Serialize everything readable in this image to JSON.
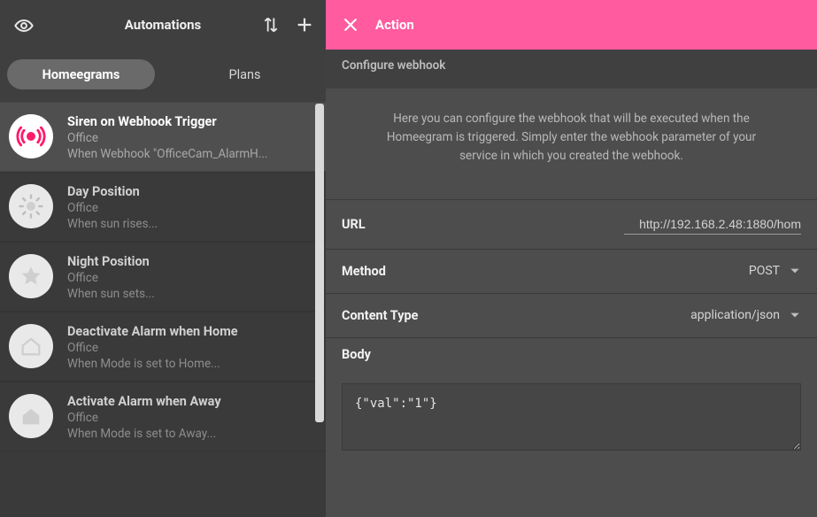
{
  "colors": {
    "accent": "#ff5b9e"
  },
  "sidebar": {
    "title": "Automations",
    "tabs": {
      "homeegrams": "Homeegrams",
      "plans": "Plans",
      "activeIndex": 0
    },
    "items": [
      {
        "title": "Siren on Webhook Trigger",
        "sub": "Office",
        "cond": "When Webhook \"OfficeCam_AlarmH...",
        "icon": "siren",
        "active": true
      },
      {
        "title": "Day Position",
        "sub": "Office",
        "cond": "When sun rises...",
        "icon": "sun",
        "active": false
      },
      {
        "title": "Night Position",
        "sub": "Office",
        "cond": "When sun sets...",
        "icon": "star",
        "active": false
      },
      {
        "title": "Deactivate Alarm when Home",
        "sub": "Office",
        "cond": "When Mode is set to Home...",
        "icon": "home",
        "active": false
      },
      {
        "title": "Activate Alarm when Away",
        "sub": "Office",
        "cond": "When Mode is set to Away...",
        "icon": "home",
        "active": false
      }
    ]
  },
  "panel": {
    "header": "Action",
    "section": "Configure webhook",
    "description": "Here you can configure the webhook that will be executed when the Homeegram is triggered. Simply enter the webhook parameter of your service in which you created the webhook.",
    "url": {
      "label": "URL",
      "value": "http://192.168.2.48:1880/hom"
    },
    "method": {
      "label": "Method",
      "value": "POST"
    },
    "ctype": {
      "label": "Content Type",
      "value": "application/json"
    },
    "body": {
      "label": "Body",
      "value": "{\"val\":\"1\"}"
    }
  }
}
